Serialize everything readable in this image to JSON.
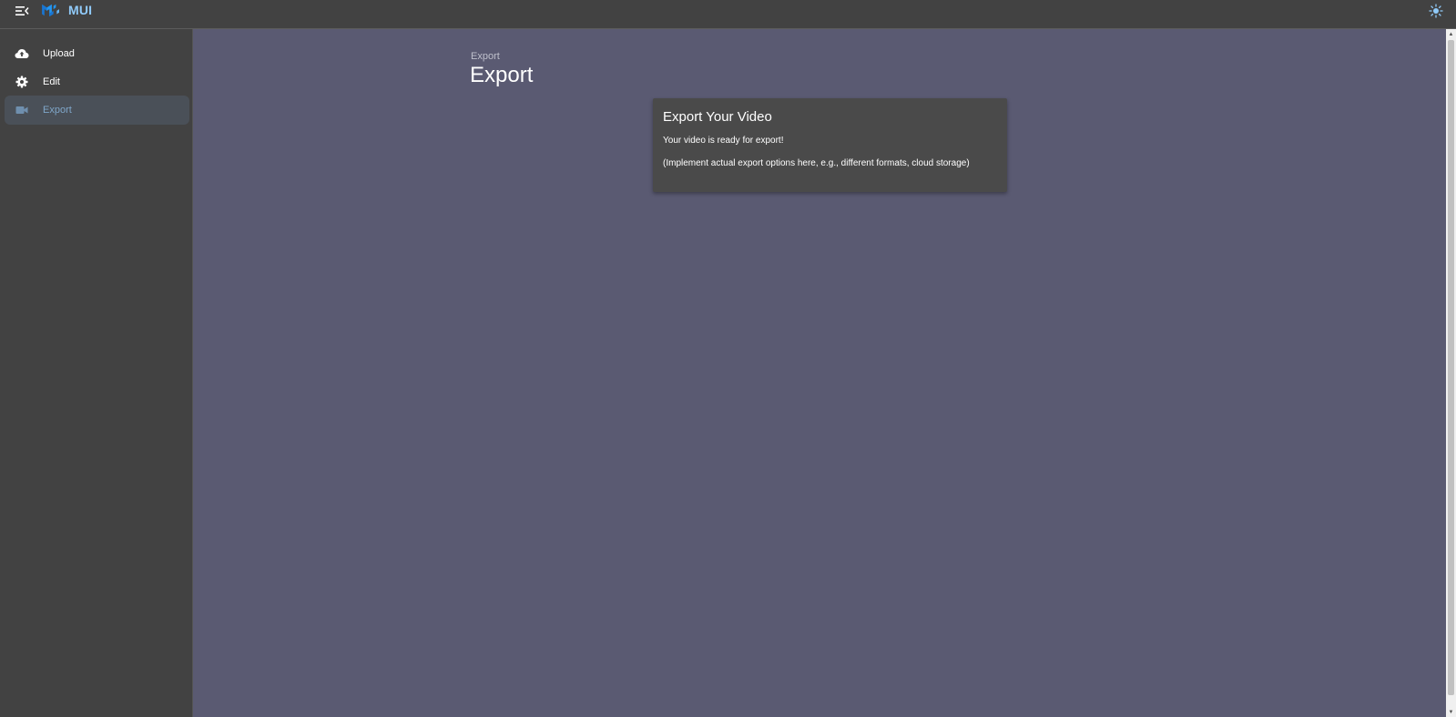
{
  "header": {
    "brand": "MUI",
    "menu_icon": "menu-open-icon",
    "logo_icon": "mui-logo-icon",
    "theme_icon": "sun-icon",
    "brand_color": "#90caf9"
  },
  "sidebar": {
    "items": [
      {
        "label": "Upload",
        "icon": "cloud-upload-icon",
        "active": false
      },
      {
        "label": "Edit",
        "icon": "gear-icon",
        "active": false
      },
      {
        "label": "Export",
        "icon": "video-camera-icon",
        "active": true
      }
    ]
  },
  "main": {
    "breadcrumb": "Export",
    "title": "Export",
    "card": {
      "title": "Export Your Video",
      "line1": "Your video is ready for export!",
      "line2": "(Implement actual export options here, e.g., different formats, cloud storage)"
    }
  },
  "colors": {
    "topbar": "#424242",
    "sidebar": "#424242",
    "main_bg": "#5a5a72",
    "card_bg": "#4a4a4a",
    "active_text": "#7fa6c9"
  }
}
